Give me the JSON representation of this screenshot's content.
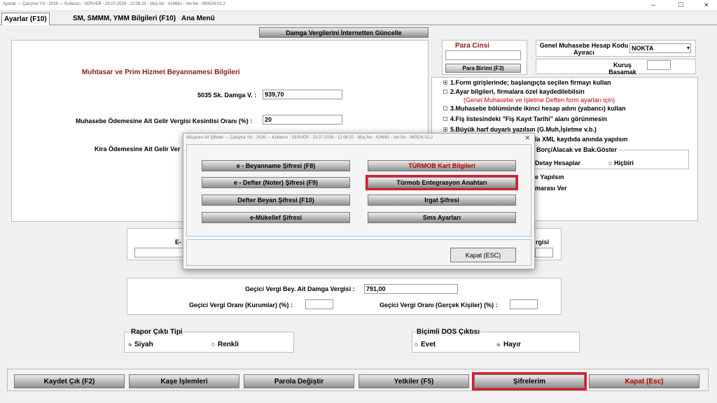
{
  "window": {
    "title": "Ayarlar  ---  Çalışma Yılı : 2026  ---  Kullanıcı : SERVER - 23.07.2026 - 12:06:25  - Müş.No : 424681  - Ver.No : 060526-02.2",
    "minimize": "─",
    "maximize": "☐",
    "close": "✕"
  },
  "tabs": [
    "Ayarlar (F10)",
    "SM, SMMM, YMM Bilgileri (F10)",
    "Ana Menü"
  ],
  "top_button": "Damga Vergilerini İnternetten Güncelle",
  "muhtasar": {
    "title": "Muhtasar ve Prim Hizmet Beyannamesi Bilgileri",
    "damga_label": "5035 Sk. Damga V. :",
    "damga_value": "939,70",
    "muhasebe_label": "Muhasebe Ödemesine Ait Gelir Vergisi Kesintisi Oranı (%) :",
    "muhasebe_value": "20",
    "kira_label": "Kira Ödemesine Ait Gelir Ver"
  },
  "para": {
    "title": "Para Cinsi",
    "value": "",
    "button": "Para Birimi (F3)"
  },
  "hesap": {
    "label": "Genel Muhasebe Hesap Kodu Ayıracı",
    "value": "NOKTA",
    "dropdown_icon": "▾"
  },
  "kurus": {
    "label": "Kuruş Basamak",
    "value": ""
  },
  "options": [
    {
      "text": "1.Form girişlerinde; başlangıçta seçilen firmayı kullan",
      "checked": true
    },
    {
      "text": "2.Ayar bilgileri, firmalara özel kaydedilebilsin",
      "checked": false
    },
    {
      "text": "(Genel Muhasebe ve İşletme Defteri form ayarları için)",
      "checked": false
    },
    {
      "text": "3.Muhasebe bölümünde ikinci hesap adını (yabancı) kullan",
      "checked": false
    },
    {
      "text": "4.Fiş listesindeki \"Fiş Kayıt Tarihi\" alanı görünmesin",
      "checked": false
    },
    {
      "text": "5.Büyük harf duyarlı yazılsın (G.Muh,İşletme v.b.)",
      "checked": true
    }
  ],
  "partial": {
    "xml": "la XML kaydıda anında yapılsın",
    "borc_title": "Borç/Alacak ve Bak.Göster",
    "detay": "Detay Hesaplar",
    "hicbiri": "Hiçbiri",
    "yapilsin": "e Yapılsın",
    "numara": "marası Ver",
    "e_label": "E-",
    "vergisi": "rgisi"
  },
  "gecici": {
    "damga_label": "Geçici Vergi Bey. Ait Damga Vergisi :",
    "damga_value": "791,00",
    "kurumlar_label": "Geçici Vergi Oranı (Kurumlar) (%) :",
    "kurumlar_value": "",
    "gercek_label": "Geçici Vergi Oranı (Gerçek Kişiler) (%) :",
    "gercek_value": ""
  },
  "rapor": {
    "title": "Rapor Çıktı Tipi",
    "siyah": "Siyah",
    "renkli": "Renkli"
  },
  "bicimli": {
    "title": "Biçimli DOS Çıktısı",
    "evet": "Evet",
    "hayir": "Hayır"
  },
  "bottom": {
    "kaydet": "Kaydet Çık (F2)",
    "kase": "Kaşe İşlemleri",
    "parola": "Parola Değiştir",
    "yetkiler": "Yetkiler (F5)",
    "sifrelerim": "Şifrelerim",
    "kapat": "Kapat (Esc)"
  },
  "dialog": {
    "title": "Müşavire Ait Şifreler  ---  Çalışma Yılı : 2026  ---  Kullanıcı : SERVER - 23.07.2026 - 12:06:32  - Müş.No : 424681  - Ver.No : 060526-02.2",
    "close": "✕",
    "beyanname": "e - Beyanname Şifresi (F8)",
    "turmob": "TÜRMOB Kart Bilgileri",
    "defter": "e - Defter (Noter) Şifresi (F9)",
    "entegrasyon": "Türmob Entegrasyon Anahtarı",
    "defter_beyan": "Defter Beyan Şifresi (F10)",
    "irgat": "Irgat Şifresi",
    "mukellef": "e-Mükellef Şifresi",
    "sms": "Sms Ayarları",
    "kapat": "Kapat (ESC)"
  },
  "colors": {
    "maroon": "#8b1a1a",
    "red": "#c00000",
    "highlight": "#e0182a"
  }
}
